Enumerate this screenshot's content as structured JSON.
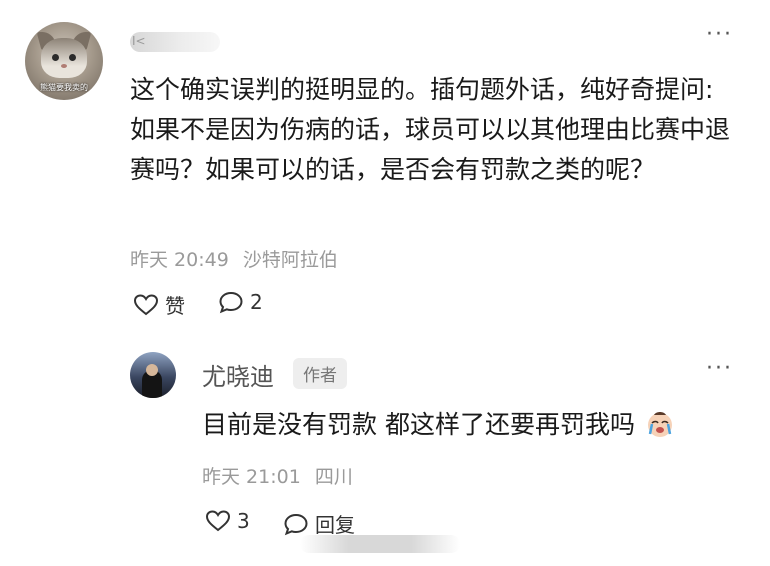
{
  "comment": {
    "avatar_caption": "熊猫要我卖的",
    "username_fragment": "I<",
    "text": "这个确实误判的挺明显的。插句题外话，纯好奇提问:如果不是因为伤病的话，球员可以以其他理由比赛中退赛吗？如果可以的话，是否会有罚款之类的呢？",
    "time": "昨天 20:49",
    "location": "沙特阿拉伯",
    "like_label": "赞",
    "comment_count": "2",
    "more_icon": "···"
  },
  "reply": {
    "name": "尤晓迪",
    "badge": "作者",
    "text": "目前是没有罚款 都这样了还要再罚我吗",
    "emoji": "crying-face-emoji",
    "time": "昨天 21:01",
    "location": "四川",
    "like_count": "3",
    "reply_label": "回复",
    "more_icon": "···"
  },
  "colors": {
    "text": "#1a1a1a",
    "meta": "#9a9a9a",
    "badge_bg": "#eeeeee"
  }
}
